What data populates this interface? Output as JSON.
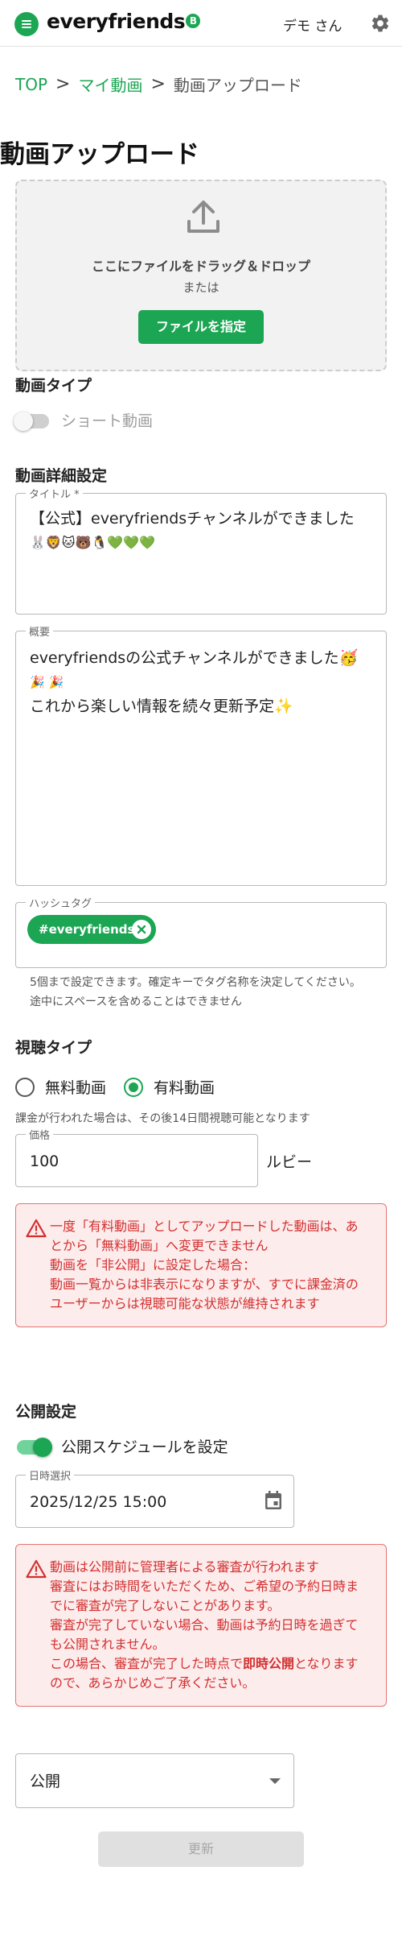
{
  "header": {
    "logo_text": "everyfriends",
    "logo_mark": "B",
    "user_name": "デモ さん",
    "icons": {
      "menu": "menu-icon",
      "settings": "gear-icon"
    },
    "brand_color": "#1ca653"
  },
  "breadcrumb": {
    "items": [
      "TOP",
      "マイ動画",
      "動画アップロード"
    ],
    "separator": ">"
  },
  "page_title": "動画アップロード",
  "dropzone": {
    "icon": "upload-icon",
    "text": "ここにファイルをドラッグ＆ドロップ",
    "or_text": "または",
    "button_label": "ファイルを指定"
  },
  "video_type": {
    "heading": "動画タイプ",
    "toggle_label": "ショート動画",
    "toggle_on": false
  },
  "details": {
    "heading": "動画詳細設定",
    "title_legend": "タイトル *",
    "title_value_line1": "【公式】everyfriendsチャンネルができました",
    "title_value_line2": "🐰🦁🐱🐻🐧💚💚💚",
    "summary_legend": "概要",
    "summary_line1": "everyfriendsの公式チャンネルができました🥳",
    "summary_line2": "🎉 🎉",
    "summary_line3": "これから楽しい情報を続々更新予定✨",
    "hashtag_legend": "ハッシュタグ",
    "hashtag_chip": "#everyfriends",
    "hashtag_help_line1": "5個まで設定できます。確定キーでタグ名称を決定してください。",
    "hashtag_help_line2": "途中にスペースを含めることはできません"
  },
  "viewing_type": {
    "heading": "視聴タイプ",
    "option_free": "無料動画",
    "option_paid": "有料動画",
    "selected": "有料動画",
    "note": "課金が行われた場合は、その後14日間視聴可能となります",
    "price_legend": "価格",
    "price_value": "100",
    "price_unit": "ルビー"
  },
  "paid_alert": {
    "icon": "warning-icon",
    "line1": "一度「有料動画」としてアップロードした動画は、あ",
    "line2": "とから「無料動画」へ変更できません",
    "line3": "動画を「非公開」に設定した場合：",
    "line4": "動画一覧からは非表示になりますが、すでに課金済の",
    "line5": "ユーザーからは視聴可能な状態が維持されます"
  },
  "publish": {
    "heading": "公開設定",
    "schedule_toggle_label": "公開スケジュールを設定",
    "schedule_toggle_on": true,
    "datetime_legend": "日時選択",
    "datetime_value": "2025/12/25 15:00",
    "visibility_value": "公開"
  },
  "publish_alert": {
    "icon": "warning-icon",
    "line1": "動画は公開前に管理者による審査が行われます",
    "line2": "審査にはお時間をいただくため、ご希望の予約日時ま",
    "line3": "でに審査が完了しないことがあります。",
    "line4": "審査が完了していない場合、動画は予約日時を過ぎて",
    "line5": "も公開されません。",
    "line6_pre": "この場合、審査が完了した時点で",
    "line6_bold": "即時公開",
    "line6_post": "となります",
    "line7": "ので、あらかじめご了承ください。"
  },
  "update_button_label": "更新"
}
